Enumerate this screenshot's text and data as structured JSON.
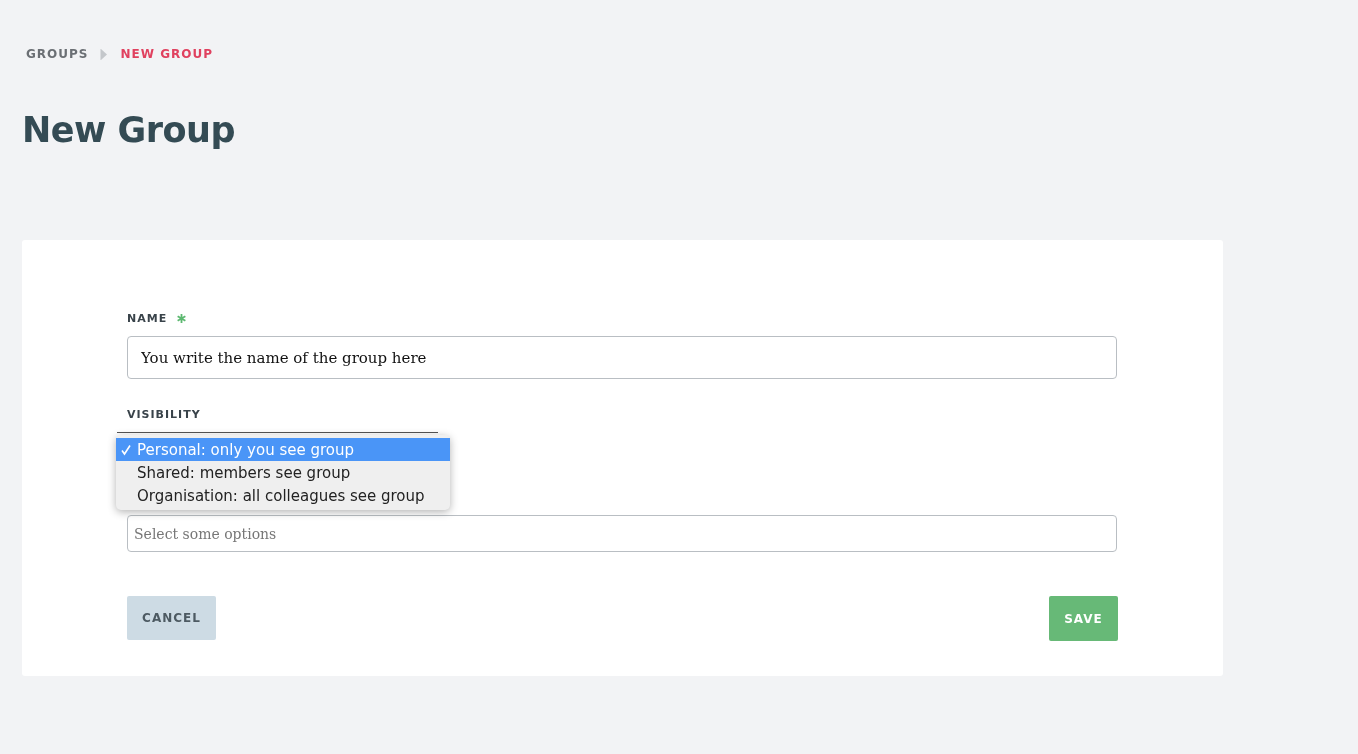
{
  "breadcrumb": [
    {
      "label": "GROUPS",
      "current": false
    },
    {
      "label": "NEW GROUP",
      "current": true
    }
  ],
  "title": "New Group",
  "form": {
    "name": {
      "label": "NAME",
      "required": true,
      "value": "You write the name of the group here"
    },
    "visibility": {
      "label": "VISIBILITY",
      "open": true,
      "options": [
        {
          "label": "Personal: only you see group",
          "selected": true
        },
        {
          "label": "Shared: members see group",
          "selected": false
        },
        {
          "label": "Organisation: all colleagues see group",
          "selected": false
        }
      ]
    },
    "members": {
      "placeholder": "Select some options"
    }
  },
  "buttons": {
    "cancel": "CANCEL",
    "save": "SAVE"
  }
}
